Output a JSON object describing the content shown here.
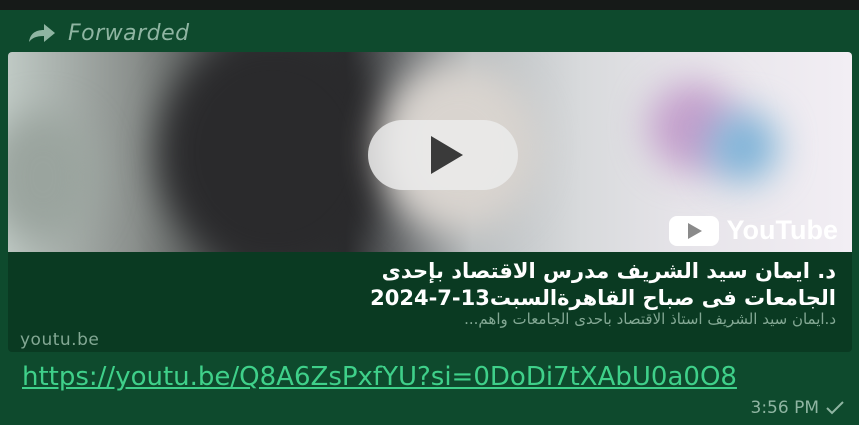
{
  "message": {
    "forwarded_label": "Forwarded",
    "preview": {
      "title_line1": "د. ايمان سيد الشريف مدرس الاقتصاد بإحدى",
      "title_line2": "الجامعات فى صباح القاهرةالسبت13-7-2024",
      "description": "د.ايمان سيد الشريف استاذ الاقتصاد باحدى الجامعات واهم...",
      "domain": "youtu.be",
      "brand": "YouTube"
    },
    "link_text": "https://youtu.be/Q8A6ZsPxfYU?si=0DoDi7tXAbU0a0O8",
    "time": "3:56 PM"
  },
  "icons": {
    "forward": "forward-arrow-icon",
    "play": "play-icon",
    "youtube": "youtube-logo-icon",
    "status": "sent-check-icon"
  },
  "colors": {
    "bubble": "#0e4a2d",
    "link": "#3fd08a",
    "muted_text": "#8fb5a2"
  }
}
